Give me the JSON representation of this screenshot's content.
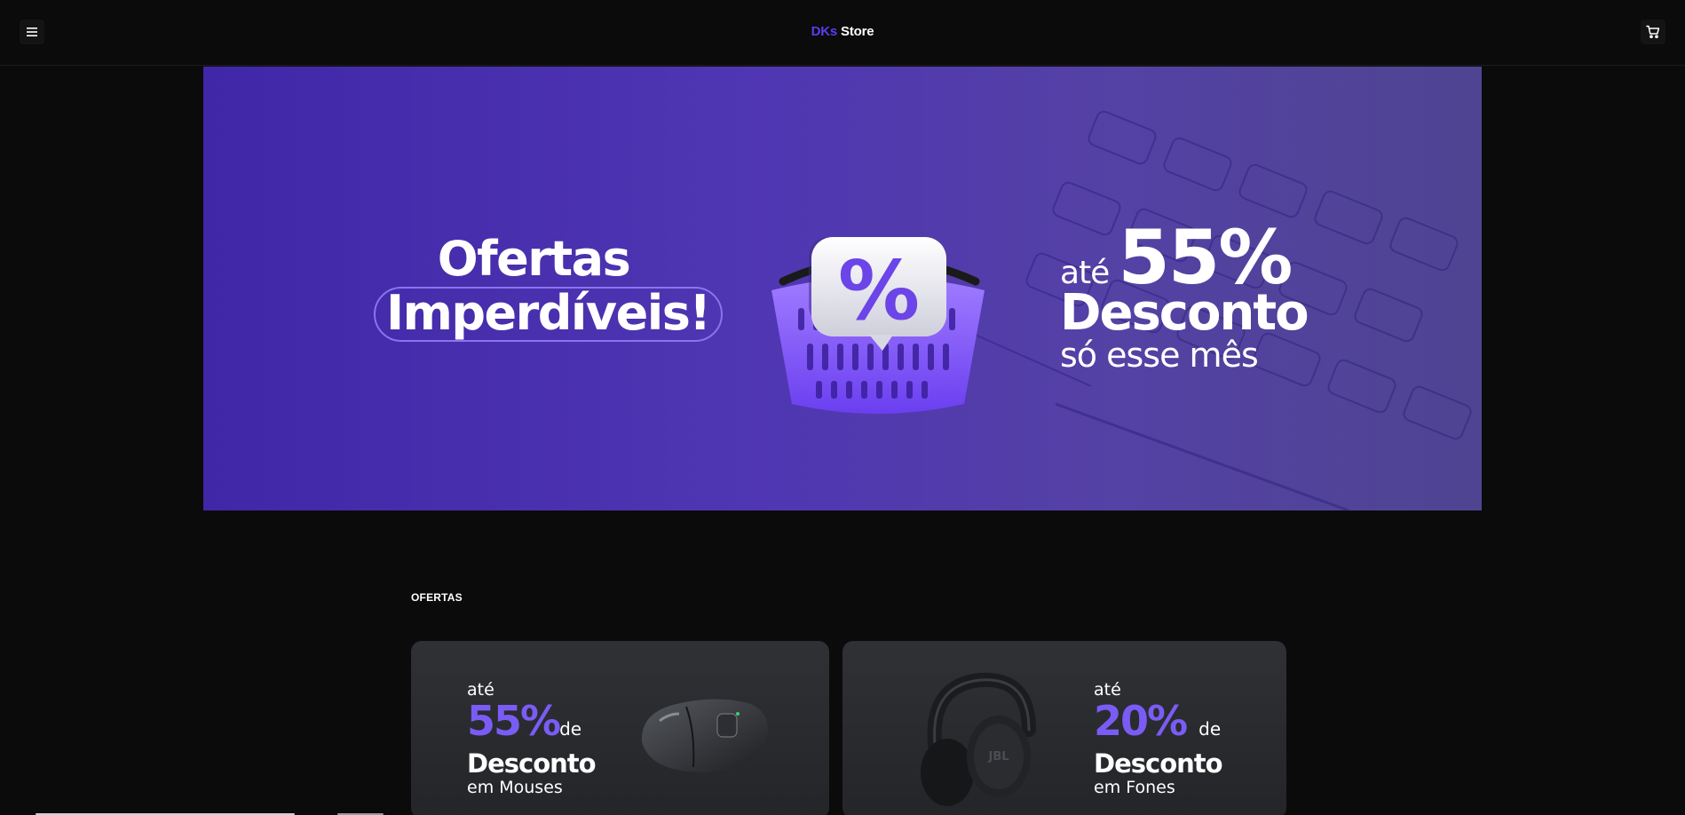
{
  "header": {
    "menu_icon": "hamburger-menu-icon",
    "logo_brand": "DKs",
    "logo_suffix": "Store",
    "cart_icon": "shopping-cart-icon"
  },
  "hero": {
    "title_line1": "Ofertas",
    "title_line2": "Imperdíveis!",
    "promo_prefix": "até",
    "promo_value": "55%",
    "promo_word": "Desconto",
    "promo_suffix": "só esse mês",
    "badge_icon": "percent-icon",
    "basket_icon": "shopping-basket-icon"
  },
  "offers": {
    "section_title": "OFERTAS",
    "cards": [
      {
        "prefix": "até",
        "value": "55%",
        "connector": "de",
        "word": "Desconto",
        "category": "em Mouses",
        "image_icon": "mouse-icon"
      },
      {
        "prefix": "até",
        "value": "20%",
        "connector": "de",
        "word": "Desconto",
        "category": "em Fones",
        "image_icon": "headphones-icon"
      }
    ]
  },
  "colors": {
    "background": "#0b0b0b",
    "accent": "#5a3cf0",
    "hero_bg": "#4530b0",
    "card_bg": "#2b2d31",
    "offer_accent": "#7a5cf5"
  }
}
